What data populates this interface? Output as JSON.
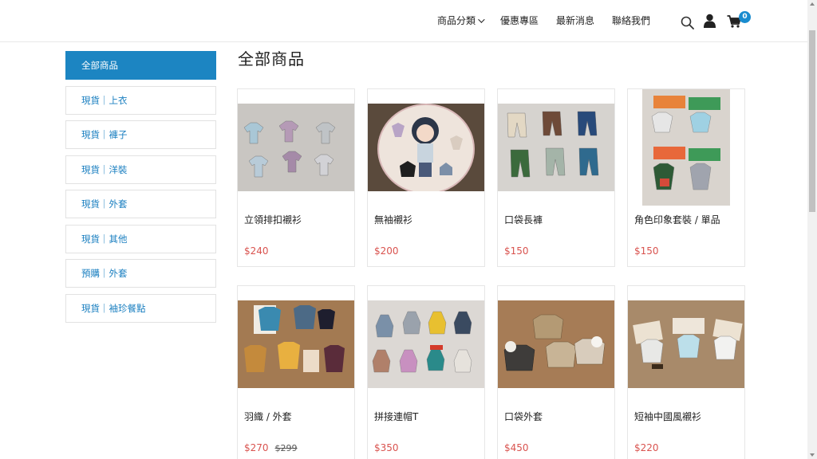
{
  "header": {
    "nav": [
      {
        "label": "商品分類",
        "dropdown": true
      },
      {
        "label": "優惠專區"
      },
      {
        "label": "最新消息"
      },
      {
        "label": "聯絡我們"
      }
    ],
    "cart_count": "0",
    "accent_color": "#1c85c2"
  },
  "sidebar": {
    "items": [
      {
        "label": "全部商品",
        "active": true
      },
      {
        "label": "現貨｜上衣"
      },
      {
        "label": "現貨｜褲子"
      },
      {
        "label": "現貨｜洋裝"
      },
      {
        "label": "現貨｜外套"
      },
      {
        "label": "現貨｜其他"
      },
      {
        "label": "預購｜外套"
      },
      {
        "label": "現貨｜袖珍餐點"
      }
    ]
  },
  "main": {
    "title": "全部商品",
    "products": [
      {
        "name": "立領排扣襯衫",
        "price": "$240",
        "old_price": ""
      },
      {
        "name": "無袖襯衫",
        "price": "$200",
        "old_price": ""
      },
      {
        "name": "口袋長褲",
        "price": "$150",
        "old_price": ""
      },
      {
        "name": "角色印象套裝 / 單品",
        "price": "$150",
        "old_price": ""
      },
      {
        "name": "羽織 / 外套",
        "price": "$270",
        "old_price": "$299"
      },
      {
        "name": "拼接連帽T",
        "price": "$350",
        "old_price": ""
      },
      {
        "name": "口袋外套",
        "price": "$450",
        "old_price": ""
      },
      {
        "name": "短袖中國風襯衫",
        "price": "$220",
        "old_price": ""
      }
    ]
  }
}
